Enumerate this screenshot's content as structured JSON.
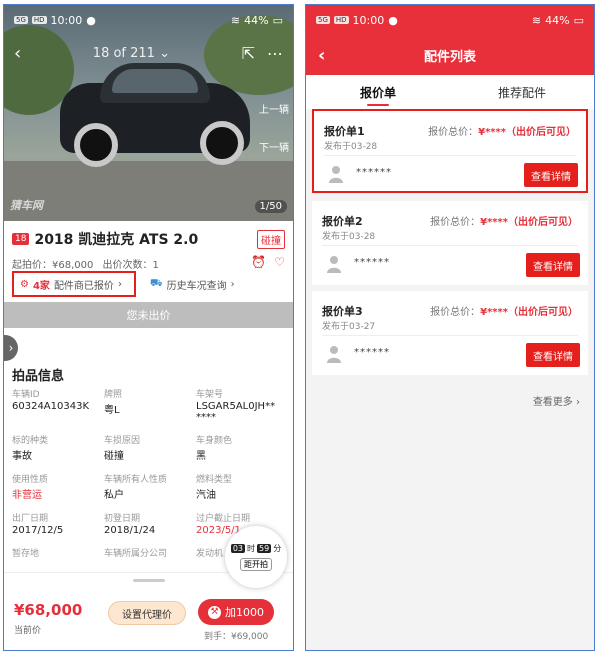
{
  "left": {
    "status": {
      "network": "5G",
      "hd": "HD",
      "time": "10:00",
      "battery": "44%"
    },
    "photo": {
      "counter": "18 of 211",
      "prev_label": "上一辆",
      "next_label": "下一辆",
      "watermark": "猜车网",
      "pager": "1/50"
    },
    "car": {
      "year_badge": "18",
      "title": "2018 凯迪拉克 ATS 2.0",
      "damage_tag": "碰撞",
      "start_price": "起拍价：¥68,000",
      "bid_count": "出价次数：1"
    },
    "quote": {
      "count": "4家",
      "text": "配件商已报价",
      "history": "历史车况查询"
    },
    "not_bid": "您未出价",
    "section_title": "拍品信息",
    "fields": [
      {
        "k": "车辆ID",
        "v": "60324A10343K"
      },
      {
        "k": "牌照",
        "v": "粤L"
      },
      {
        "k": "车架号",
        "v": "LSGAR5AL0JH**\n****"
      },
      {
        "k": "标的种类",
        "v": "事故"
      },
      {
        "k": "车损原因",
        "v": "碰撞"
      },
      {
        "k": "车身颜色",
        "v": "黑"
      },
      {
        "k": "使用性质",
        "v": "非营运",
        "red": true
      },
      {
        "k": "车辆所有人性质",
        "v": "私户"
      },
      {
        "k": "燃料类型",
        "v": "汽油"
      },
      {
        "k": "出厂日期",
        "v": "2017/12/5"
      },
      {
        "k": "初登日期",
        "v": "2018/1/24"
      },
      {
        "k": "过户截止日期",
        "v": "2023/5/1",
        "red": true
      },
      {
        "k": "暂存地",
        "v": ""
      },
      {
        "k": "车辆所属分公司",
        "v": ""
      },
      {
        "k": "发动机",
        "v": ""
      }
    ],
    "timer": {
      "hours": "03",
      "h_unit": "时",
      "minutes": "59",
      "m_unit": "分",
      "label": "距开拍"
    },
    "bottom": {
      "price": "¥68,000",
      "price_label": "当前价",
      "agent_button": "设置代理价",
      "add_button": "加1000",
      "arrive": "到手：¥69,000"
    }
  },
  "right": {
    "status": {
      "network": "5G",
      "hd": "HD",
      "time": "10:00",
      "battery": "44%"
    },
    "title": "配件列表",
    "tabs": [
      "报价单",
      "推荐配件"
    ],
    "quotes": [
      {
        "name": "报价单1",
        "date": "发布于03-28",
        "total_label": "报价总价：",
        "total_value": "¥****（出价后可见）",
        "user": "******",
        "button": "查看详情"
      },
      {
        "name": "报价单2",
        "date": "发布于03-28",
        "total_label": "报价总价：",
        "total_value": "¥****（出价后可见）",
        "user": "******",
        "button": "查看详情"
      },
      {
        "name": "报价单3",
        "date": "发布于03-27",
        "total_label": "报价总价：",
        "total_value": "¥****（出价后可见）",
        "user": "******",
        "button": "查看详情"
      }
    ],
    "more": "查看更多"
  }
}
